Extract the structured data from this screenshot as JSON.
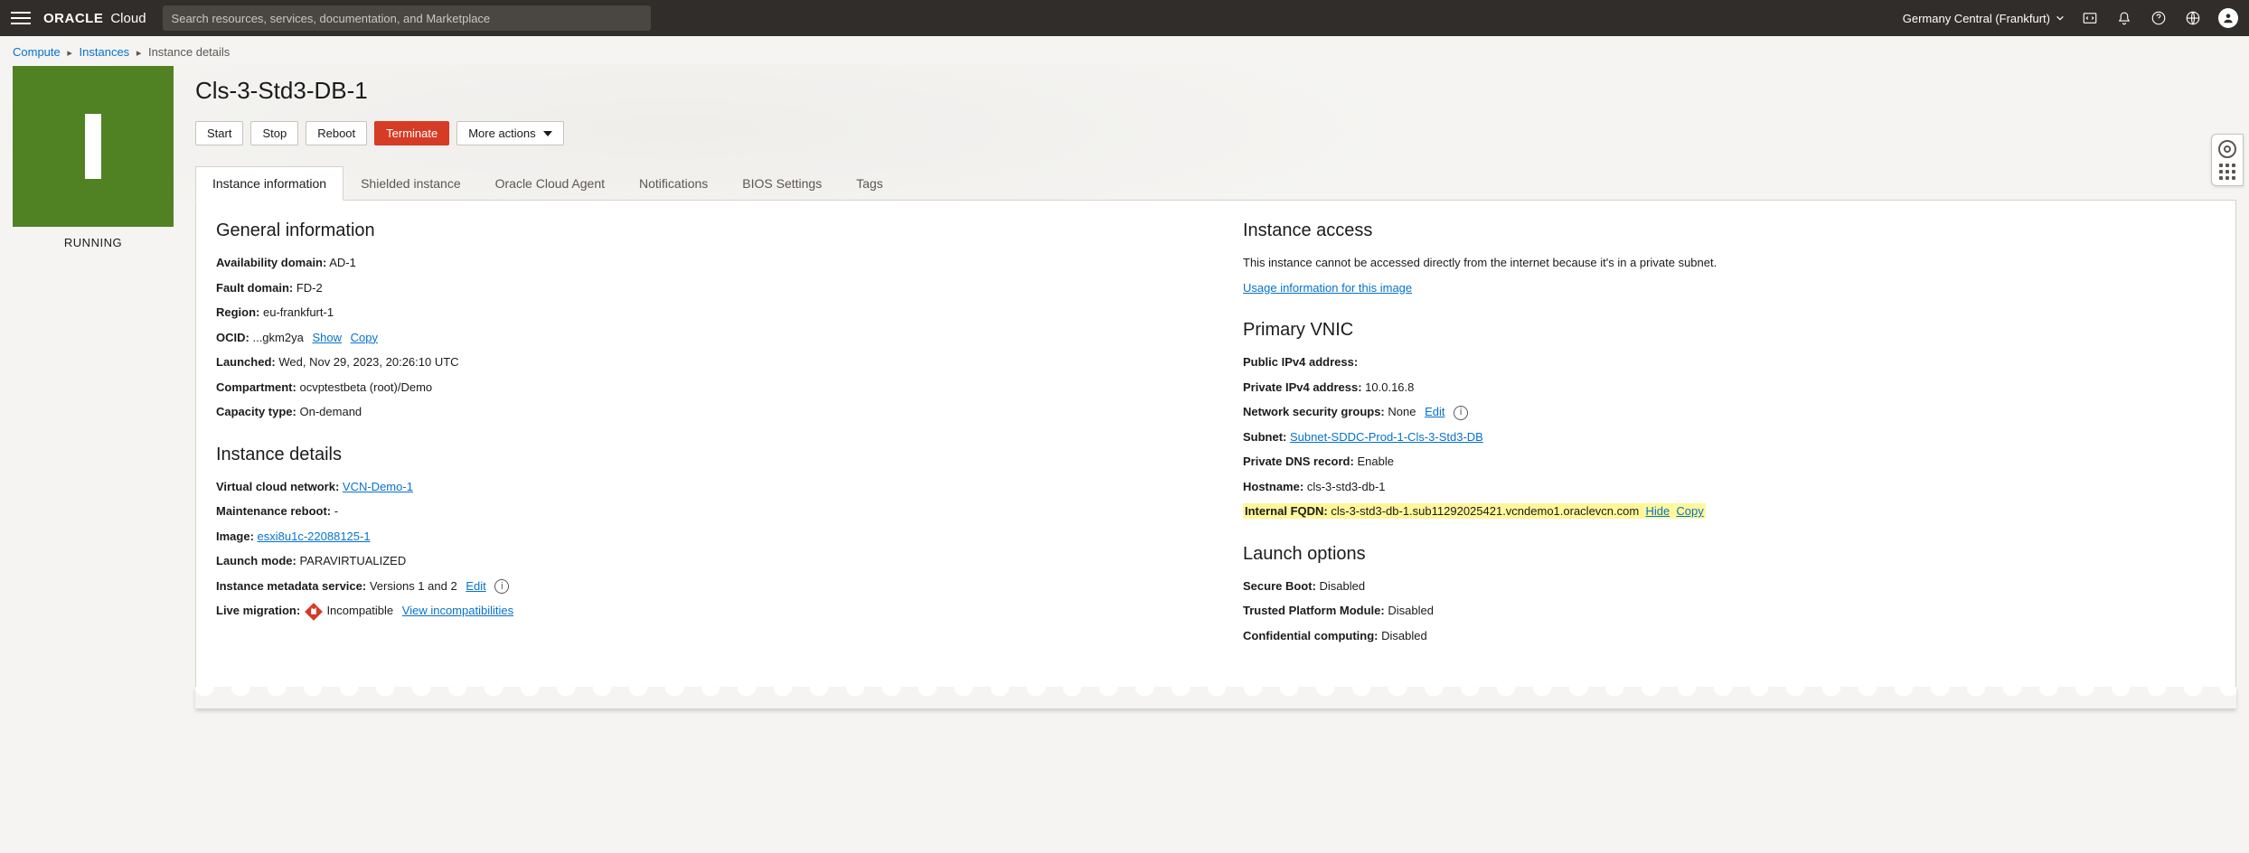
{
  "topbar": {
    "brand_bold": "ORACLE",
    "brand_light": "Cloud",
    "search_placeholder": "Search resources, services, documentation, and Marketplace",
    "region": "Germany Central (Frankfurt)"
  },
  "breadcrumbs": {
    "compute": "Compute",
    "instances": "Instances",
    "current": "Instance details"
  },
  "status": {
    "label": "RUNNING"
  },
  "title": "Cls-3-Std3-DB-1",
  "actions": {
    "start": "Start",
    "stop": "Stop",
    "reboot": "Reboot",
    "terminate": "Terminate",
    "more": "More actions"
  },
  "tabs": {
    "info": "Instance information",
    "shielded": "Shielded instance",
    "agent": "Oracle Cloud Agent",
    "notifications": "Notifications",
    "bios": "BIOS Settings",
    "tags": "Tags"
  },
  "general": {
    "heading": "General information",
    "ad_k": "Availability domain:",
    "ad_v": "AD-1",
    "fd_k": "Fault domain:",
    "fd_v": "FD-2",
    "region_k": "Region:",
    "region_v": "eu-frankfurt-1",
    "ocid_k": "OCID:",
    "ocid_v": "...gkm2ya",
    "show": "Show",
    "copy": "Copy",
    "launched_k": "Launched:",
    "launched_v": "Wed, Nov 29, 2023, 20:26:10 UTC",
    "compartment_k": "Compartment:",
    "compartment_v": "ocvptestbeta (root)/Demo",
    "captype_k": "Capacity type:",
    "captype_v": "On-demand"
  },
  "details": {
    "heading": "Instance details",
    "vcn_k": "Virtual cloud network:",
    "vcn_link": "VCN-Demo-1",
    "maint_k": "Maintenance reboot:",
    "maint_v": "-",
    "image_k": "Image:",
    "image_link": "esxi8u1c-22088125-1",
    "launchmode_k": "Launch mode:",
    "launchmode_v": "PARAVIRTUALIZED",
    "metadata_k": "Instance metadata service:",
    "metadata_v": "Versions 1 and 2",
    "edit": "Edit",
    "livemig_k": "Live migration:",
    "livemig_v": "Incompatible",
    "viewincompat": "View incompatibilities"
  },
  "access": {
    "heading": "Instance access",
    "note": "This instance cannot be accessed directly from the internet because it's in a private subnet.",
    "usage_link": "Usage information for this image"
  },
  "vnic": {
    "heading": "Primary VNIC",
    "pubip_k": "Public IPv4 address:",
    "pubip_v": "",
    "privip_k": "Private IPv4 address:",
    "privip_v": "10.0.16.8",
    "nsg_k": "Network security groups:",
    "nsg_v": "None",
    "nsg_edit": "Edit",
    "subnet_k": "Subnet:",
    "subnet_link": "Subnet-SDDC-Prod-1-Cls-3-Std3-DB",
    "pdns_k": "Private DNS record:",
    "pdns_v": "Enable",
    "hostname_k": "Hostname:",
    "hostname_v": "cls-3-std3-db-1",
    "fqdn_k": "Internal FQDN:",
    "fqdn_v": "cls-3-std3-db-1.sub11292025421.vcndemo1.oraclevcn.com",
    "hide": "Hide",
    "copy": "Copy"
  },
  "launch": {
    "heading": "Launch options",
    "secure_k": "Secure Boot:",
    "secure_v": "Disabled",
    "tpm_k": "Trusted Platform Module:",
    "tpm_v": "Disabled",
    "conf_k": "Confidential computing:",
    "conf_v": "Disabled"
  }
}
